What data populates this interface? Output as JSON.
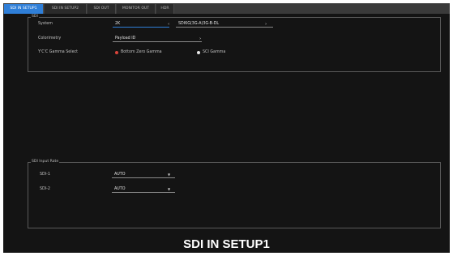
{
  "tabs": [
    {
      "label": "SDI IN SETUP1",
      "active": true
    },
    {
      "label": "SDI IN SETUP2",
      "active": false
    },
    {
      "label": "SDI OUT",
      "active": false
    },
    {
      "label": "MONITOR OUT",
      "active": false
    },
    {
      "label": "HDR",
      "active": false
    }
  ],
  "sdi_group": {
    "title": "SDI",
    "system_label": "System",
    "system_value_1": "2K",
    "system_value_2": "SDI6G(3G-A)3G-B-DL",
    "colorimetry_label": "Colorimetry",
    "colorimetry_value": "Payload ID",
    "ycc_label": "Y'C'C Gamma Select",
    "option_1": "Bottom Zero Gamma",
    "option_2": "SCI Gamma",
    "option_1_color": "#d9443b",
    "option_2_color": "#e6e6e6"
  },
  "input_rate_group": {
    "title": "SDI Input Rate",
    "rows": [
      {
        "label": "SDI-1",
        "value": "AUTO"
      },
      {
        "label": "SDI-2",
        "value": "AUTO"
      }
    ]
  },
  "footer": {
    "title": "SDI IN SETUP1"
  },
  "colors": {
    "accent": "#2f7fd8",
    "background": "#141414"
  }
}
